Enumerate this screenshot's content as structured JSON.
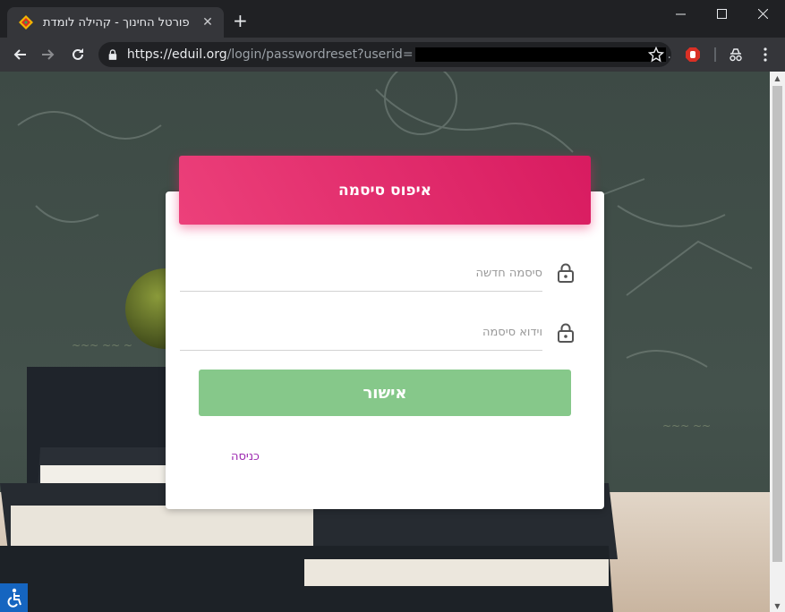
{
  "browser": {
    "tab_title": "פורטל החינוך - קהילה לומדת",
    "tab_close": "✕",
    "new_tab": "+",
    "url_host": "https://eduil.org",
    "url_path": "/login/passwordreset?userid=",
    "url_tail": "."
  },
  "form": {
    "title": "איפוס סיסמה",
    "new_password_placeholder": "סיסמה חדשה",
    "confirm_password_placeholder": "וידוא סיסמה",
    "submit_label": "אישור",
    "login_link": "כניסה"
  },
  "colors": {
    "header_accent": "#e91e63",
    "submit_button": "#86c88a",
    "link": "#9c27b0"
  }
}
